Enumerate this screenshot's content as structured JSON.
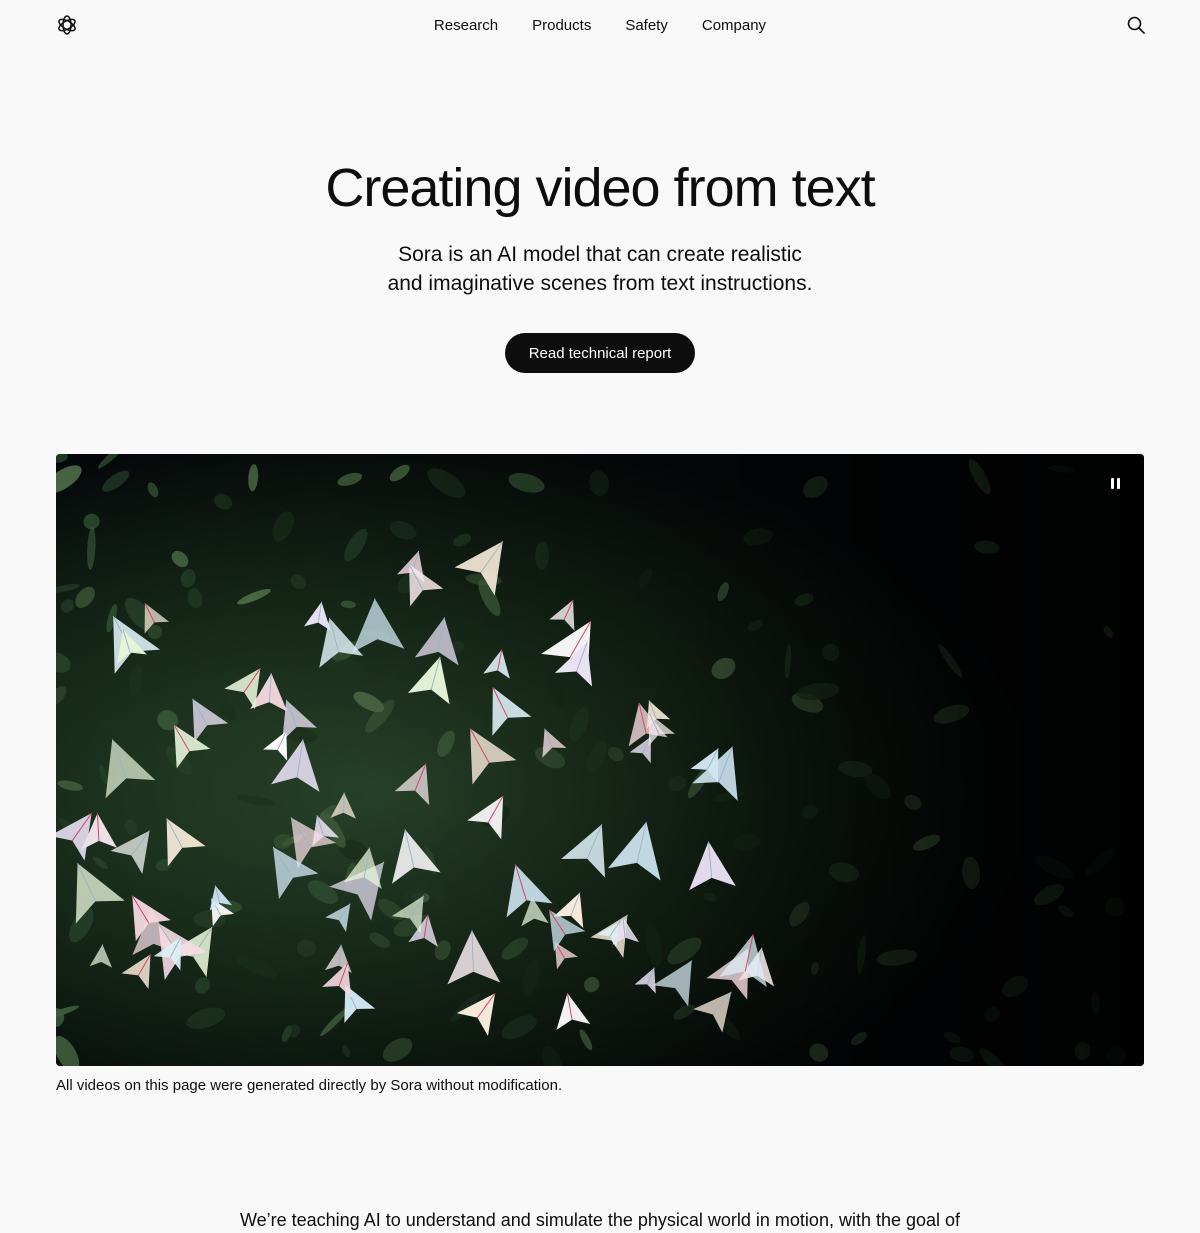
{
  "header": {
    "logo_icon": "openai-logo-icon",
    "nav": [
      {
        "label": "Research"
      },
      {
        "label": "Products"
      },
      {
        "label": "Safety"
      },
      {
        "label": "Company"
      }
    ],
    "search_icon": "search-icon"
  },
  "hero": {
    "title": "Creating video from text",
    "subtitle_line1": "Sora is an AI model that can create realistic",
    "subtitle_line2": "and imaginative scenes from text instructions.",
    "cta_label": "Read technical report"
  },
  "video": {
    "control_icon": "pause-icon",
    "caption": "All videos on this page were generated directly by Sora without modification."
  },
  "body": {
    "intro_text": "We’re teaching AI to understand and simulate the physical world in motion, with the goal of"
  },
  "colors": {
    "background": "#f9f9f9",
    "text": "#0d0d0d",
    "button_bg": "#0d0d0d",
    "button_text": "#ffffff",
    "foliage_dark": "#0b140d",
    "foliage": "#1f3a22"
  }
}
